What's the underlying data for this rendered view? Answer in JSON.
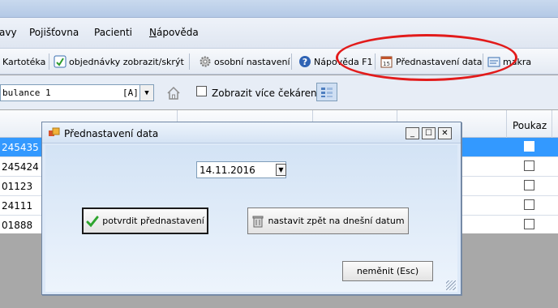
{
  "menu": {
    "items": [
      "avy",
      "Pojišťovna",
      "Pacienti",
      "Nápověda"
    ]
  },
  "toolbar": {
    "kartoteka": "Kartotéka",
    "objednavky": "objednávky zobrazit/skrýt",
    "osobni": "osobní nastavení",
    "napoveda": "Nápověda F1",
    "prednastaveni": "Přednastavení data",
    "makra": "makra"
  },
  "filter": {
    "ambulance": "bulance 1",
    "ambulance_code": "[A]",
    "more_label": "Zobrazit více čekáren:"
  },
  "table": {
    "poukaz_header": "Poukaz",
    "rows": [
      {
        "id": "245435",
        "selected": true
      },
      {
        "id": "245424",
        "selected": false
      },
      {
        "id": "01123",
        "selected": false
      },
      {
        "id": "24111",
        "selected": false
      },
      {
        "id": "01888",
        "selected": false
      }
    ]
  },
  "dialog": {
    "title": "Přednastavení data",
    "date_value": "14.11.2016",
    "confirm_label": "potvrdit přednastavení",
    "reset_label": "nastavit zpět na dnešní datum",
    "cancel_label": "neměnit (Esc)"
  },
  "colors": {
    "selection": "#3399ff",
    "annotation": "#e21b1b"
  }
}
